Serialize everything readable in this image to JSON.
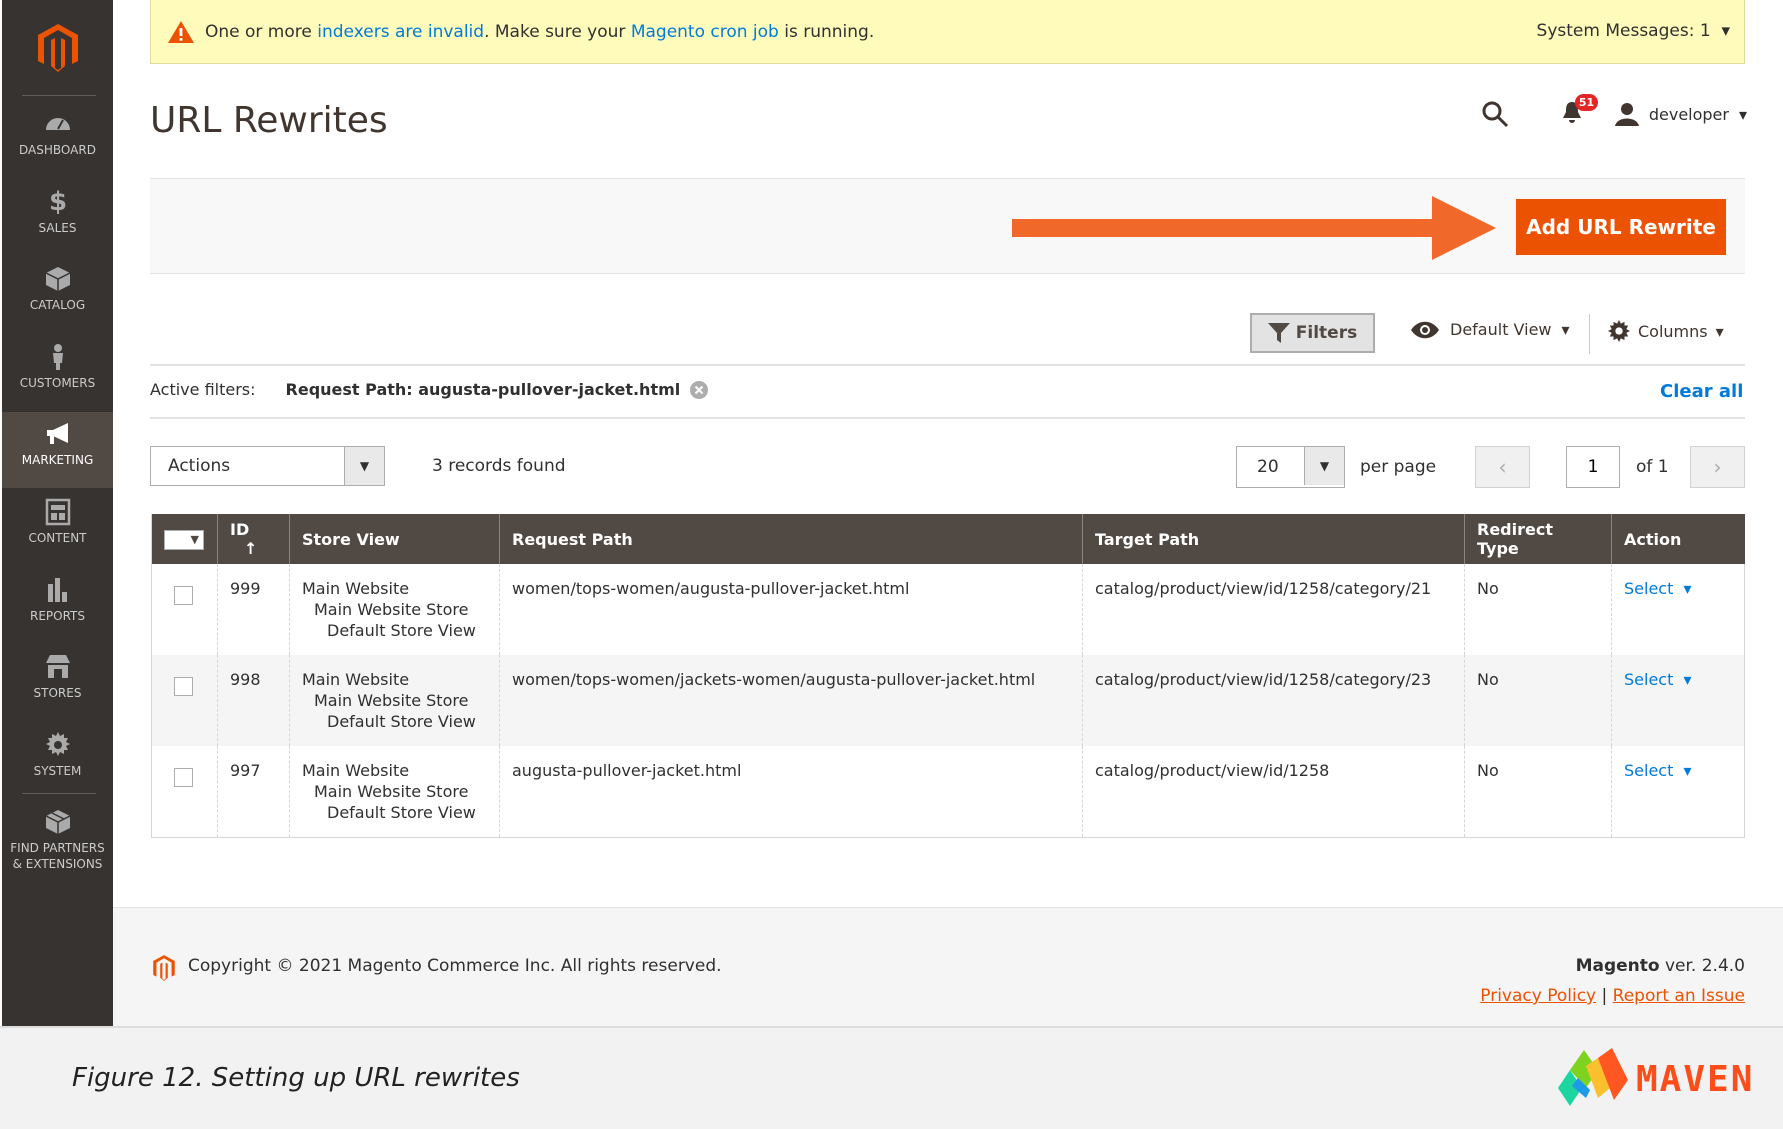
{
  "colors": {
    "accent": "#eb5202",
    "link": "#007bdb",
    "sidebar": "#373330",
    "banner": "#fffbbb"
  },
  "banner": {
    "prefix": "One or more ",
    "link1": "indexers are invalid",
    "mid": ". Make sure your ",
    "link2": "Magento cron job",
    "suffix": " is running.",
    "system_messages": "System Messages: 1"
  },
  "sidebar": {
    "items": [
      {
        "label": "DASHBOARD",
        "icon": "dashboard-icon"
      },
      {
        "label": "SALES",
        "icon": "dollar-icon"
      },
      {
        "label": "CATALOG",
        "icon": "box-icon"
      },
      {
        "label": "CUSTOMERS",
        "icon": "person-icon"
      },
      {
        "label": "MARKETING",
        "icon": "megaphone-icon",
        "active": true
      },
      {
        "label": "CONTENT",
        "icon": "layout-icon"
      },
      {
        "label": "REPORTS",
        "icon": "bar-chart-icon"
      },
      {
        "label": "STORES",
        "icon": "store-icon"
      },
      {
        "label": "SYSTEM",
        "icon": "gear-icon"
      },
      {
        "label": "FIND PARTNERS",
        "label2": "& EXTENSIONS",
        "icon": "cube-icon"
      }
    ]
  },
  "header": {
    "title": "URL Rewrites",
    "notifications": "51",
    "user": "developer"
  },
  "toolbar": {
    "add_label": "Add URL Rewrite",
    "filters": "Filters",
    "view": "Default View",
    "columns": "Columns"
  },
  "active_filters": {
    "label": "Active filters:",
    "filter": "Request Path: augusta-pullover-jacket.html",
    "clear": "Clear all"
  },
  "grid": {
    "actions": "Actions",
    "records": "3 records found",
    "per_page_value": "20",
    "per_page_label": "per page",
    "page": "1",
    "of": "of 1",
    "columns": [
      "ID",
      "Store View",
      "Request Path",
      "Target Path",
      "Redirect Type",
      "Action"
    ],
    "rows": [
      {
        "id": "999",
        "store": [
          "Main Website",
          "Main Website Store",
          "Default Store View"
        ],
        "request": "women/tops-women/augusta-pullover-jacket.html",
        "target": "catalog/product/view/id/1258/category/21",
        "redirect": "No",
        "action": "Select"
      },
      {
        "id": "998",
        "store": [
          "Main Website",
          "Main Website Store",
          "Default Store View"
        ],
        "request": "women/tops-women/jackets-women/augusta-pullover-jacket.html",
        "target": "catalog/product/view/id/1258/category/23",
        "redirect": "No",
        "action": "Select"
      },
      {
        "id": "997",
        "store": [
          "Main Website",
          "Main Website Store",
          "Default Store View"
        ],
        "request": "augusta-pullover-jacket.html",
        "target": "catalog/product/view/id/1258",
        "redirect": "No",
        "action": "Select"
      }
    ]
  },
  "footer": {
    "copyright": "Copyright © 2021 Magento Commerce Inc. All rights reserved.",
    "brand": "Magento",
    "version": " ver. 2.4.0",
    "privacy": "Privacy Policy",
    "sep": "|",
    "report": "Report an Issue"
  },
  "caption": {
    "text": "Figure 12. Setting up URL rewrites",
    "logo": "MAVEN"
  }
}
